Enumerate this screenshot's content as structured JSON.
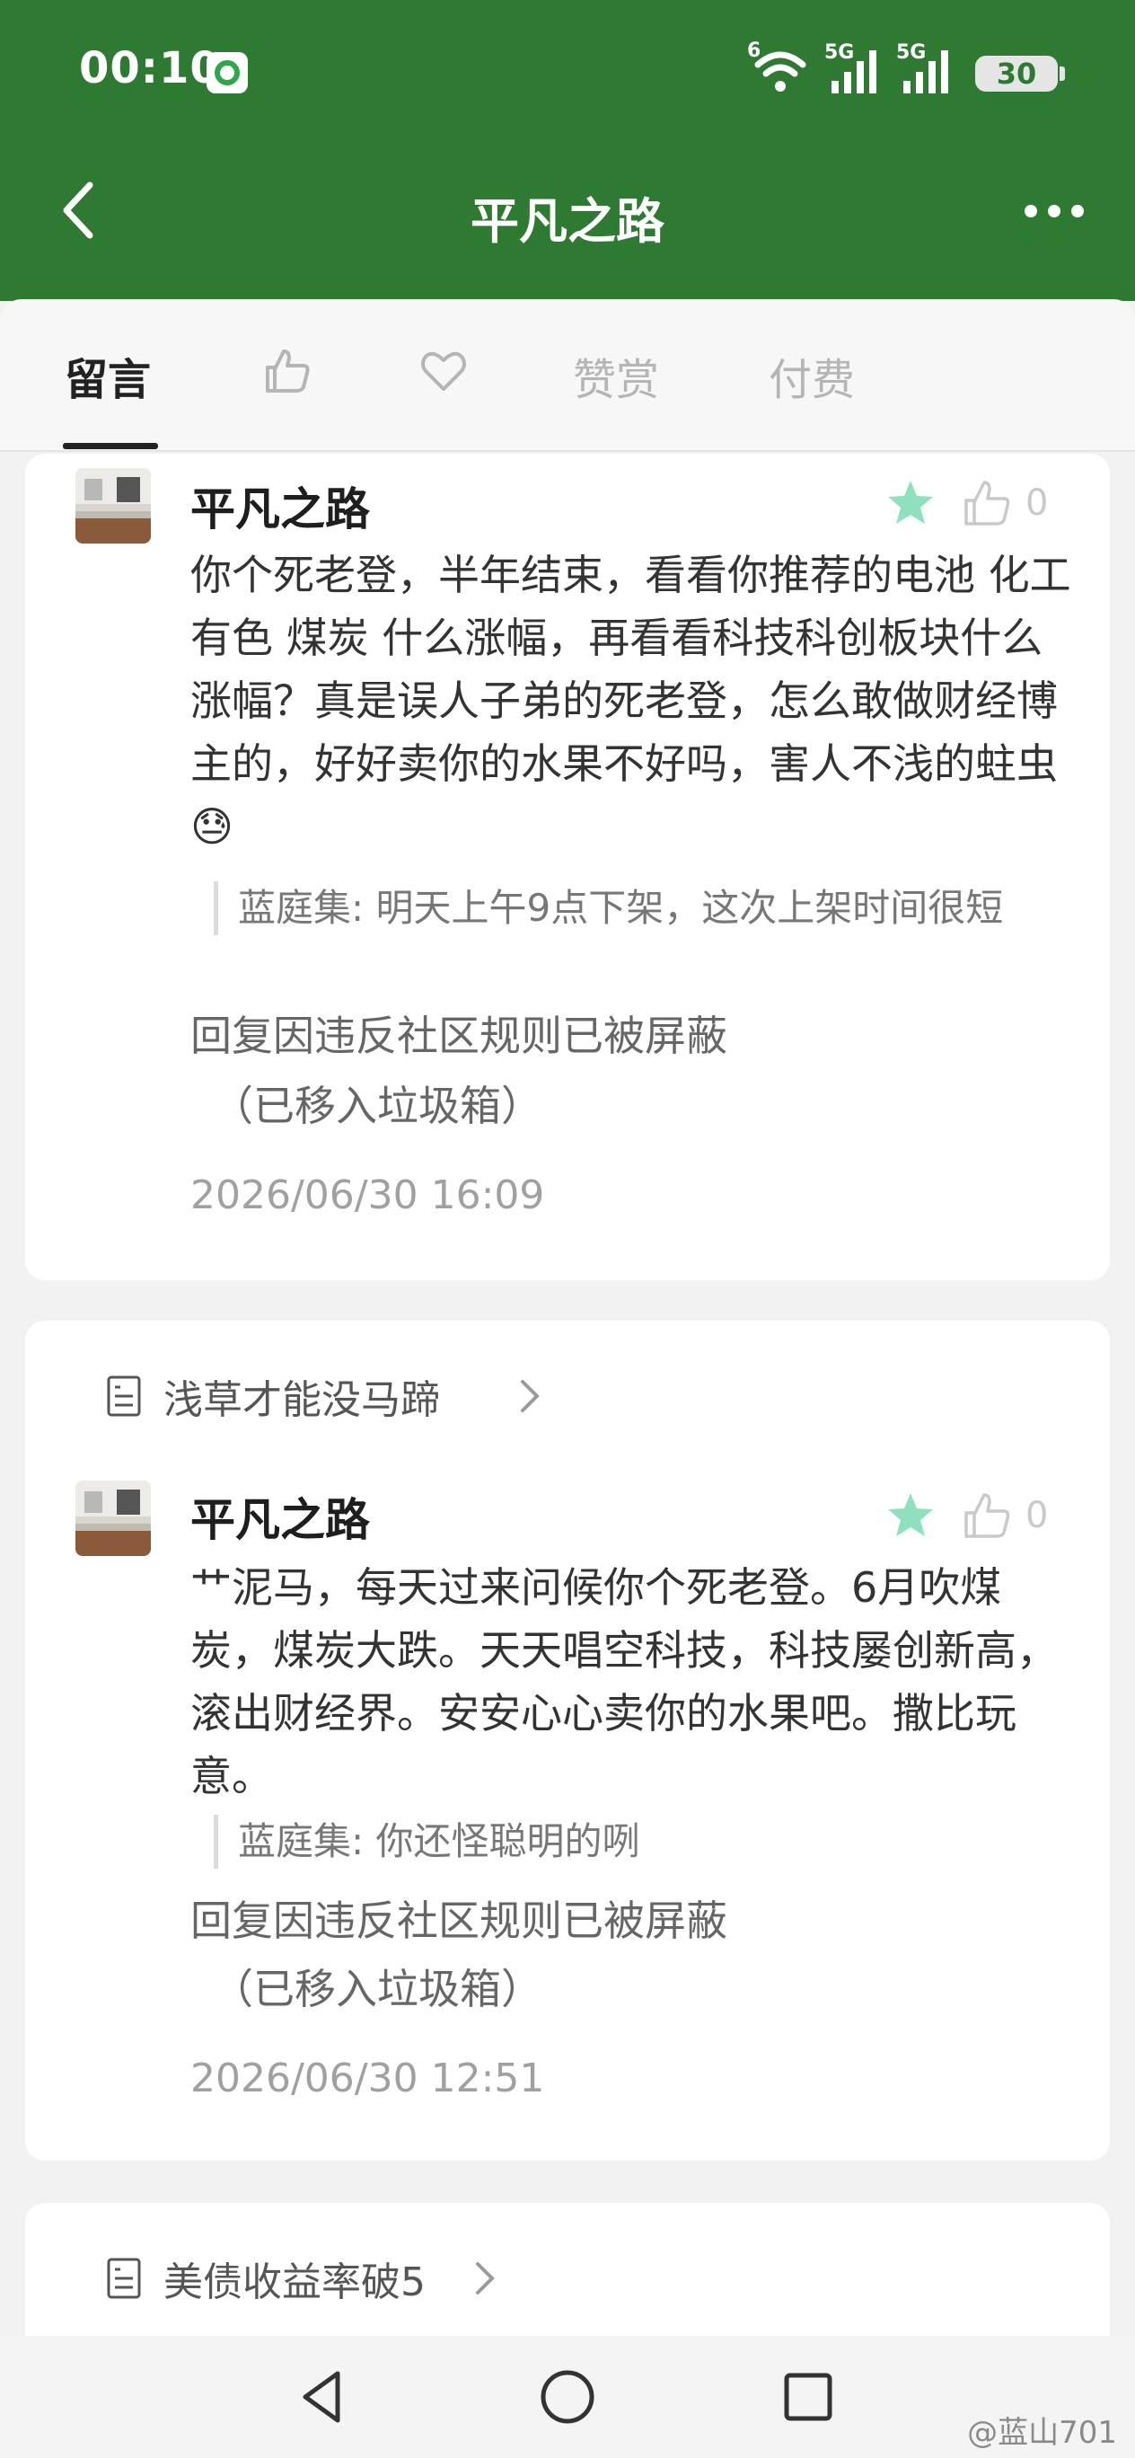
{
  "status_bar": {
    "time": "00:10",
    "battery": "30",
    "network_1": "5G",
    "network_2": "5G",
    "wifi_level": "6"
  },
  "header": {
    "title": "平凡之路"
  },
  "tabs": [
    {
      "label": "留言",
      "active": true
    },
    {
      "icon": "thumbs-up-icon"
    },
    {
      "icon": "heart-icon"
    },
    {
      "label": "赞赏"
    },
    {
      "label": "付费"
    }
  ],
  "comments": [
    {
      "user": "平凡之路",
      "likes": "0",
      "text": "你个死老登，半年结束，看看你推荐的电池 化工 有色 煤炭 什么涨幅，再看看科技科创板块什么涨幅？真是误人子弟的死老登，怎么敢做财经博主的，好好卖你的水果不好吗，害人不浅的蛀虫😓",
      "reply": "蓝庭集: 明天上午9点下架，这次上架时间很短",
      "blocked": "回复因违反社区规则已被屏蔽",
      "blocked_note": "（已移入垃圾箱）",
      "time": "2026/06/30 16:09"
    },
    {
      "article": "浅草才能没马蹄",
      "user": "平凡之路",
      "likes": "0",
      "text": "艹泥马，每天过来问候你个死老登。6月吹煤炭，煤炭大跌。天天唱空科技，科技屡创新高，滚出财经界。安安心心卖你的水果吧。撒比玩意。",
      "reply": "蓝庭集: 你还怪聪明的咧",
      "blocked": "回复因违反社区规则已被屏蔽",
      "blocked_note": "（已移入垃圾箱）",
      "time": "2026/06/30 12:51"
    },
    {
      "article": "美债收益率破5"
    }
  ],
  "watermark": "@蓝山701",
  "colors": {
    "header_bg": "#2f7a32",
    "star": "#8fe0bf"
  }
}
